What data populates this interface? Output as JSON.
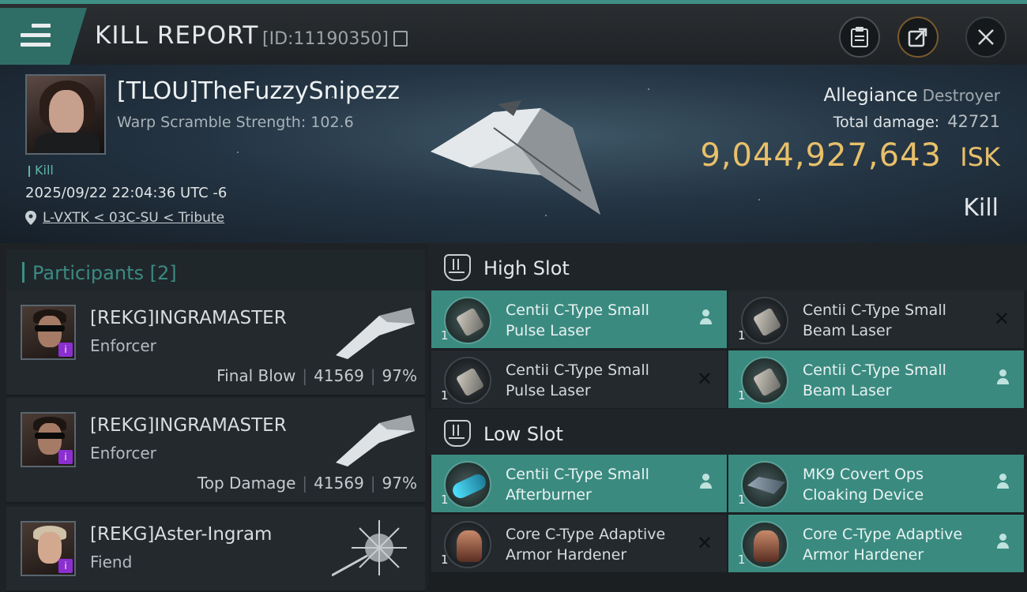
{
  "header": {
    "title": "KILL REPORT",
    "report_id": "[ID:11190350]",
    "icons": [
      "menu-icon",
      "copy-icon",
      "clipboard-icon",
      "share-icon",
      "close-icon"
    ]
  },
  "victim": {
    "name": "[TLOU]TheFuzzySnipezz",
    "warp_scramble": "Warp Scramble Strength: 102.6",
    "kill_tag": "Kill",
    "timestamp": "2025/09/22 22:04:36 UTC -6",
    "location": "L-VXTK < 03C-SU < Tribute",
    "ship": "Allegiance",
    "ship_class": "Destroyer",
    "total_damage_label": "Total damage:",
    "total_damage": "42721",
    "isk_value": "9,044,927,643",
    "isk_unit": "ISK",
    "result": "Kill"
  },
  "participants": {
    "label": "Participants",
    "count": "[2]",
    "items": [
      {
        "name": "[REKG]INGRAMASTER",
        "ship_class": "Enforcer",
        "role": "Final Blow",
        "damage": "41569",
        "percent": "97%"
      },
      {
        "name": "[REKG]INGRAMASTER",
        "ship_class": "Enforcer",
        "role": "Top Damage",
        "damage": "41569",
        "percent": "97%"
      },
      {
        "name": "[REKG]Aster-Ingram",
        "ship_class": "Fiend"
      }
    ]
  },
  "fittings": {
    "high_slot": {
      "label": "High Slot",
      "items": [
        {
          "qty": "1",
          "line1": "Centii C-Type Small",
          "line2": "Pulse Laser",
          "status": "person"
        },
        {
          "qty": "1",
          "line1": "Centii C-Type Small",
          "line2": "Beam Laser",
          "status": "x"
        },
        {
          "qty": "1",
          "line1": "Centii C-Type Small",
          "line2": "Pulse Laser",
          "status": "x"
        },
        {
          "qty": "1",
          "line1": "Centii C-Type Small",
          "line2": "Beam Laser",
          "status": "person"
        }
      ]
    },
    "low_slot": {
      "label": "Low Slot",
      "items": [
        {
          "qty": "1",
          "line1": "Centii C-Type Small",
          "line2": "Afterburner",
          "status": "person"
        },
        {
          "qty": "1",
          "line1": "MK9 Covert Ops",
          "line2": "Cloaking Device",
          "status": "person"
        },
        {
          "qty": "1",
          "line1": "Core C-Type Adaptive",
          "line2": "Armor Hardener",
          "status": "x"
        },
        {
          "qty": "1",
          "line1": "Core C-Type Adaptive",
          "line2": "Armor Hardener",
          "status": "person"
        }
      ]
    }
  },
  "colors": {
    "accent": "#3a8a80",
    "isk": "#e8c06a",
    "header_stripe": "#3f8f86"
  }
}
